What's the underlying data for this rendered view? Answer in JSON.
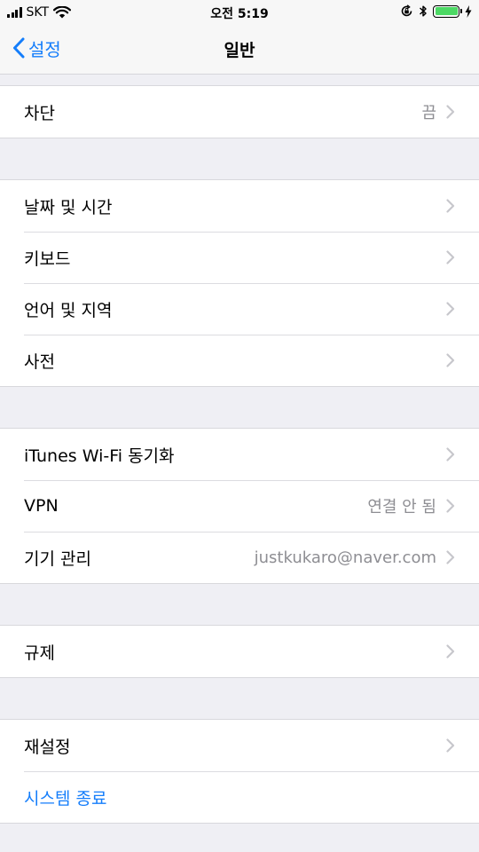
{
  "status_bar": {
    "carrier": "SKT",
    "time": "오전 5:19"
  },
  "nav": {
    "back_label": "설정",
    "title": "일반"
  },
  "groups": [
    [
      {
        "label": "차단",
        "value": "끔"
      }
    ],
    [
      {
        "label": "날짜 및 시간",
        "value": ""
      },
      {
        "label": "키보드",
        "value": ""
      },
      {
        "label": "언어 및 지역",
        "value": ""
      },
      {
        "label": "사전",
        "value": ""
      }
    ],
    [
      {
        "label": "iTunes Wi-Fi 동기화",
        "value": ""
      },
      {
        "label": "VPN",
        "value": "연결 안 됨"
      },
      {
        "label": "기기 관리",
        "value": "justkukaro@naver.com"
      }
    ],
    [
      {
        "label": "규제",
        "value": ""
      }
    ],
    [
      {
        "label": "재설정",
        "value": ""
      }
    ]
  ],
  "shutdown_label": "시스템 종료",
  "colors": {
    "accent": "#157efb",
    "battery": "#4cd964",
    "background": "#efeff4"
  }
}
